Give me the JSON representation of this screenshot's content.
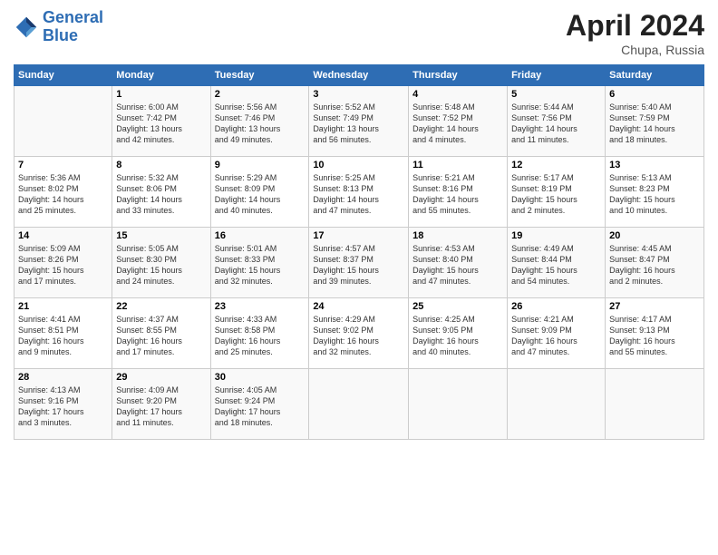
{
  "header": {
    "logo_line1": "General",
    "logo_line2": "Blue",
    "month_title": "April 2024",
    "subtitle": "Chupa, Russia"
  },
  "days_of_week": [
    "Sunday",
    "Monday",
    "Tuesday",
    "Wednesday",
    "Thursday",
    "Friday",
    "Saturday"
  ],
  "weeks": [
    [
      {
        "num": "",
        "info": ""
      },
      {
        "num": "1",
        "info": "Sunrise: 6:00 AM\nSunset: 7:42 PM\nDaylight: 13 hours\nand 42 minutes."
      },
      {
        "num": "2",
        "info": "Sunrise: 5:56 AM\nSunset: 7:46 PM\nDaylight: 13 hours\nand 49 minutes."
      },
      {
        "num": "3",
        "info": "Sunrise: 5:52 AM\nSunset: 7:49 PM\nDaylight: 13 hours\nand 56 minutes."
      },
      {
        "num": "4",
        "info": "Sunrise: 5:48 AM\nSunset: 7:52 PM\nDaylight: 14 hours\nand 4 minutes."
      },
      {
        "num": "5",
        "info": "Sunrise: 5:44 AM\nSunset: 7:56 PM\nDaylight: 14 hours\nand 11 minutes."
      },
      {
        "num": "6",
        "info": "Sunrise: 5:40 AM\nSunset: 7:59 PM\nDaylight: 14 hours\nand 18 minutes."
      }
    ],
    [
      {
        "num": "7",
        "info": "Sunrise: 5:36 AM\nSunset: 8:02 PM\nDaylight: 14 hours\nand 25 minutes."
      },
      {
        "num": "8",
        "info": "Sunrise: 5:32 AM\nSunset: 8:06 PM\nDaylight: 14 hours\nand 33 minutes."
      },
      {
        "num": "9",
        "info": "Sunrise: 5:29 AM\nSunset: 8:09 PM\nDaylight: 14 hours\nand 40 minutes."
      },
      {
        "num": "10",
        "info": "Sunrise: 5:25 AM\nSunset: 8:13 PM\nDaylight: 14 hours\nand 47 minutes."
      },
      {
        "num": "11",
        "info": "Sunrise: 5:21 AM\nSunset: 8:16 PM\nDaylight: 14 hours\nand 55 minutes."
      },
      {
        "num": "12",
        "info": "Sunrise: 5:17 AM\nSunset: 8:19 PM\nDaylight: 15 hours\nand 2 minutes."
      },
      {
        "num": "13",
        "info": "Sunrise: 5:13 AM\nSunset: 8:23 PM\nDaylight: 15 hours\nand 10 minutes."
      }
    ],
    [
      {
        "num": "14",
        "info": "Sunrise: 5:09 AM\nSunset: 8:26 PM\nDaylight: 15 hours\nand 17 minutes."
      },
      {
        "num": "15",
        "info": "Sunrise: 5:05 AM\nSunset: 8:30 PM\nDaylight: 15 hours\nand 24 minutes."
      },
      {
        "num": "16",
        "info": "Sunrise: 5:01 AM\nSunset: 8:33 PM\nDaylight: 15 hours\nand 32 minutes."
      },
      {
        "num": "17",
        "info": "Sunrise: 4:57 AM\nSunset: 8:37 PM\nDaylight: 15 hours\nand 39 minutes."
      },
      {
        "num": "18",
        "info": "Sunrise: 4:53 AM\nSunset: 8:40 PM\nDaylight: 15 hours\nand 47 minutes."
      },
      {
        "num": "19",
        "info": "Sunrise: 4:49 AM\nSunset: 8:44 PM\nDaylight: 15 hours\nand 54 minutes."
      },
      {
        "num": "20",
        "info": "Sunrise: 4:45 AM\nSunset: 8:47 PM\nDaylight: 16 hours\nand 2 minutes."
      }
    ],
    [
      {
        "num": "21",
        "info": "Sunrise: 4:41 AM\nSunset: 8:51 PM\nDaylight: 16 hours\nand 9 minutes."
      },
      {
        "num": "22",
        "info": "Sunrise: 4:37 AM\nSunset: 8:55 PM\nDaylight: 16 hours\nand 17 minutes."
      },
      {
        "num": "23",
        "info": "Sunrise: 4:33 AM\nSunset: 8:58 PM\nDaylight: 16 hours\nand 25 minutes."
      },
      {
        "num": "24",
        "info": "Sunrise: 4:29 AM\nSunset: 9:02 PM\nDaylight: 16 hours\nand 32 minutes."
      },
      {
        "num": "25",
        "info": "Sunrise: 4:25 AM\nSunset: 9:05 PM\nDaylight: 16 hours\nand 40 minutes."
      },
      {
        "num": "26",
        "info": "Sunrise: 4:21 AM\nSunset: 9:09 PM\nDaylight: 16 hours\nand 47 minutes."
      },
      {
        "num": "27",
        "info": "Sunrise: 4:17 AM\nSunset: 9:13 PM\nDaylight: 16 hours\nand 55 minutes."
      }
    ],
    [
      {
        "num": "28",
        "info": "Sunrise: 4:13 AM\nSunset: 9:16 PM\nDaylight: 17 hours\nand 3 minutes."
      },
      {
        "num": "29",
        "info": "Sunrise: 4:09 AM\nSunset: 9:20 PM\nDaylight: 17 hours\nand 11 minutes."
      },
      {
        "num": "30",
        "info": "Sunrise: 4:05 AM\nSunset: 9:24 PM\nDaylight: 17 hours\nand 18 minutes."
      },
      {
        "num": "",
        "info": ""
      },
      {
        "num": "",
        "info": ""
      },
      {
        "num": "",
        "info": ""
      },
      {
        "num": "",
        "info": ""
      }
    ]
  ]
}
